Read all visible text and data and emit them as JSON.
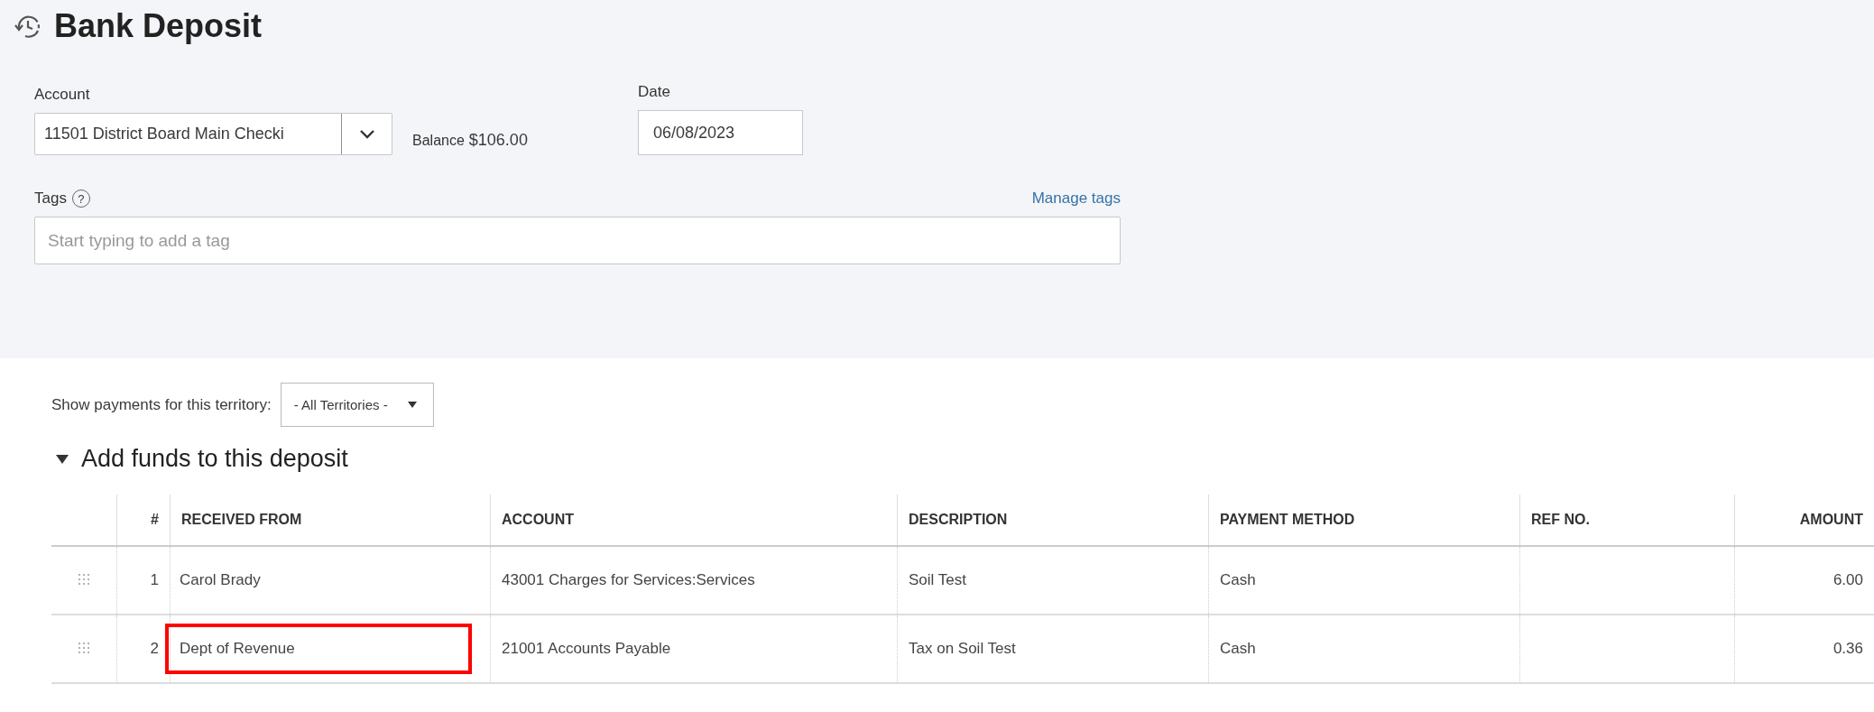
{
  "page": {
    "title": "Bank Deposit"
  },
  "form": {
    "account_label": "Account",
    "account_value": "11501 District Board Main Checki",
    "balance_label": "Balance",
    "balance_value": "$106.00",
    "date_label": "Date",
    "date_value": "06/08/2023",
    "tags_label": "Tags",
    "help_icon": "?",
    "manage_tags": "Manage tags",
    "tags_placeholder": "Start typing to add a tag"
  },
  "territory": {
    "label": "Show payments for this territory:",
    "value": "- All Territories -"
  },
  "section": {
    "title": "Add funds to this deposit",
    "expanded": true
  },
  "table": {
    "columns": [
      "#",
      "RECEIVED FROM",
      "ACCOUNT",
      "DESCRIPTION",
      "PAYMENT METHOD",
      "REF NO.",
      "AMOUNT"
    ],
    "rows": [
      {
        "number": "1",
        "received_from": "Carol Brady",
        "account": "43001 Charges for Services:Services",
        "description": "Soil Test",
        "payment_method": "Cash",
        "amount": "6.00",
        "highlighted": false
      },
      {
        "number": "2",
        "received_from": "Dept of Revenue",
        "account": "21001 Accounts Payable",
        "description": "Tax on Soil Test",
        "payment_method": "Cash",
        "amount": "0.36",
        "highlighted": true
      }
    ]
  }
}
